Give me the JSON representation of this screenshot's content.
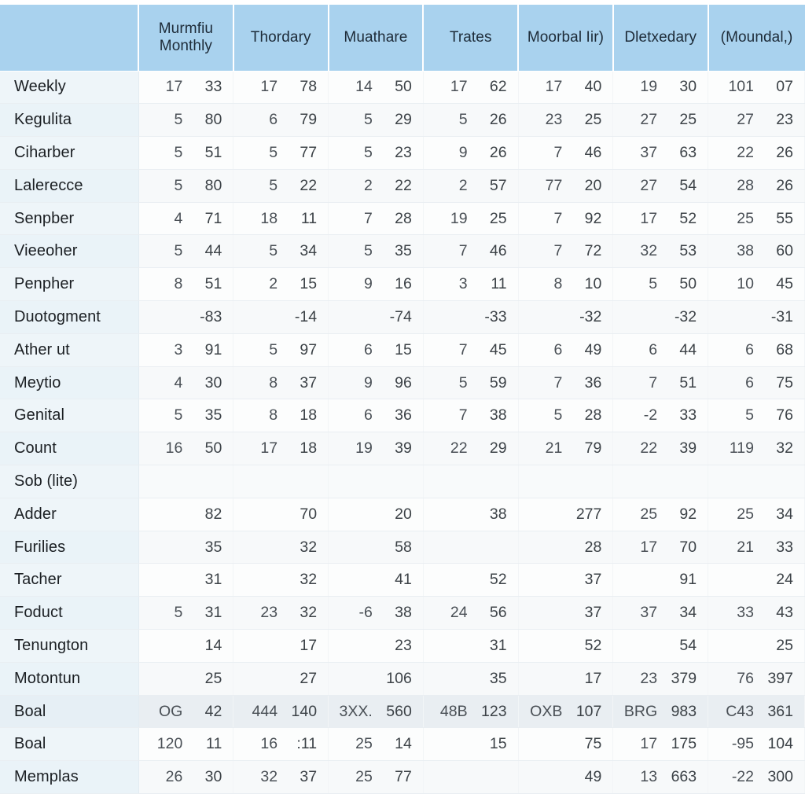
{
  "table": {
    "columns": [
      {
        "id": "rowlabel",
        "label": ""
      },
      {
        "id": "c1",
        "label": "Murmfiu Monthly"
      },
      {
        "id": "c2",
        "label": "Thordary"
      },
      {
        "id": "c3",
        "label": "Muathare"
      },
      {
        "id": "c4",
        "label": "Trates"
      },
      {
        "id": "c5",
        "label": "Moorbal Iir)"
      },
      {
        "id": "c6",
        "label": "Dletxedary"
      },
      {
        "id": "c7",
        "label": "(Moundal,)"
      }
    ],
    "rows": [
      {
        "label": "Weekly",
        "style": "normal",
        "cells": [
          [
            "17",
            "33"
          ],
          [
            "17",
            "78"
          ],
          [
            "14",
            "50"
          ],
          [
            "17",
            "62"
          ],
          [
            "17",
            "40"
          ],
          [
            "19",
            "30"
          ],
          [
            "101",
            "07"
          ]
        ]
      },
      {
        "label": "Kegulita",
        "style": "alt",
        "cells": [
          [
            "5",
            "80"
          ],
          [
            "6",
            "79"
          ],
          [
            "5",
            "29"
          ],
          [
            "5",
            "26"
          ],
          [
            "23",
            "25"
          ],
          [
            "27",
            "25"
          ],
          [
            "27",
            "23"
          ]
        ]
      },
      {
        "label": "Ciharber",
        "style": "normal",
        "cells": [
          [
            "5",
            "51"
          ],
          [
            "5",
            "77"
          ],
          [
            "5",
            "23"
          ],
          [
            "9",
            "26"
          ],
          [
            "7",
            "46"
          ],
          [
            "37",
            "63"
          ],
          [
            "22",
            "26"
          ]
        ]
      },
      {
        "label": "Lalerecce",
        "style": "alt",
        "cells": [
          [
            "5",
            "80"
          ],
          [
            "5",
            "22"
          ],
          [
            "2",
            "22"
          ],
          [
            "2",
            "57"
          ],
          [
            "77",
            "20"
          ],
          [
            "27",
            "54"
          ],
          [
            "28",
            "26"
          ]
        ]
      },
      {
        "label": "Senpber",
        "style": "normal",
        "cells": [
          [
            "4",
            "71"
          ],
          [
            "18",
            "11"
          ],
          [
            "7",
            "28"
          ],
          [
            "19",
            "25"
          ],
          [
            "7",
            "92"
          ],
          [
            "17",
            "52"
          ],
          [
            "25",
            "55"
          ]
        ]
      },
      {
        "label": "Vieeoher",
        "style": "alt",
        "cells": [
          [
            "5",
            "44"
          ],
          [
            "5",
            "34"
          ],
          [
            "5",
            "35"
          ],
          [
            "7",
            "46"
          ],
          [
            "7",
            "72"
          ],
          [
            "32",
            "53"
          ],
          [
            "38",
            "60"
          ]
        ]
      },
      {
        "label": "Penpher",
        "style": "normal",
        "cells": [
          [
            "8",
            "51"
          ],
          [
            "2",
            "15"
          ],
          [
            "9",
            "16"
          ],
          [
            "3",
            "11"
          ],
          [
            "8",
            "10"
          ],
          [
            "5",
            "50"
          ],
          [
            "10",
            "45"
          ]
        ]
      },
      {
        "label": "Duotogment",
        "style": "alt",
        "cells": [
          [
            "",
            "-83"
          ],
          [
            "",
            "-14"
          ],
          [
            "",
            "-74"
          ],
          [
            "",
            "-33"
          ],
          [
            "",
            "-32"
          ],
          [
            "",
            "-32"
          ],
          [
            "",
            "-31"
          ]
        ]
      },
      {
        "label": "Ather ut",
        "style": "normal",
        "cells": [
          [
            "3",
            "91"
          ],
          [
            "5",
            "97"
          ],
          [
            "6",
            "15"
          ],
          [
            "7",
            "45"
          ],
          [
            "6",
            "49"
          ],
          [
            "6",
            "44"
          ],
          [
            "6",
            "68"
          ]
        ]
      },
      {
        "label": "Meytio",
        "style": "alt",
        "cells": [
          [
            "4",
            "30"
          ],
          [
            "8",
            "37"
          ],
          [
            "9",
            "96"
          ],
          [
            "5",
            "59"
          ],
          [
            "7",
            "36"
          ],
          [
            "7",
            "51"
          ],
          [
            "6",
            "75"
          ]
        ]
      },
      {
        "label": "Genital",
        "style": "normal",
        "cells": [
          [
            "5",
            "35"
          ],
          [
            "8",
            "18"
          ],
          [
            "6",
            "36"
          ],
          [
            "7",
            "38"
          ],
          [
            "5",
            "28"
          ],
          [
            "-2",
            "33"
          ],
          [
            "5",
            "76"
          ]
        ]
      },
      {
        "label": "Count",
        "style": "alt",
        "cells": [
          [
            "16",
            "50"
          ],
          [
            "17",
            "18"
          ],
          [
            "19",
            "39"
          ],
          [
            "22",
            "29"
          ],
          [
            "21",
            "79"
          ],
          [
            "22",
            "39"
          ],
          [
            "119",
            "32"
          ]
        ]
      },
      {
        "label": "Sob (lite)",
        "style": "blank",
        "cells": [
          [
            "",
            ""
          ],
          [
            "",
            ""
          ],
          [
            "",
            ""
          ],
          [
            "",
            ""
          ],
          [
            "",
            ""
          ],
          [
            "",
            ""
          ],
          [
            "",
            ""
          ]
        ]
      },
      {
        "label": "Adder",
        "style": "normal",
        "cells": [
          [
            "",
            "82"
          ],
          [
            "",
            "70"
          ],
          [
            "",
            "20"
          ],
          [
            "",
            "38"
          ],
          [
            "",
            "277"
          ],
          [
            "25",
            "92"
          ],
          [
            "25",
            "34"
          ]
        ]
      },
      {
        "label": "Furilies",
        "style": "alt",
        "cells": [
          [
            "",
            "35"
          ],
          [
            "",
            "32"
          ],
          [
            "",
            "58"
          ],
          [
            "",
            ""
          ],
          [
            "",
            "28"
          ],
          [
            "17",
            "70"
          ],
          [
            "21",
            "33"
          ]
        ]
      },
      {
        "label": "Tacher",
        "style": "normal",
        "cells": [
          [
            "",
            "31"
          ],
          [
            "",
            "32"
          ],
          [
            "",
            "41"
          ],
          [
            "",
            "52"
          ],
          [
            "",
            "37"
          ],
          [
            "",
            "91"
          ],
          [
            "",
            "24"
          ]
        ]
      },
      {
        "label": "Foduct",
        "style": "alt",
        "cells": [
          [
            "5",
            "31"
          ],
          [
            "23",
            "32"
          ],
          [
            "-6",
            "38"
          ],
          [
            "24",
            "56"
          ],
          [
            "",
            "37"
          ],
          [
            "37",
            "34"
          ],
          [
            "33",
            "43"
          ]
        ]
      },
      {
        "label": "Tenungton",
        "style": "normal",
        "cells": [
          [
            "",
            "14"
          ],
          [
            "",
            "17"
          ],
          [
            "",
            "23"
          ],
          [
            "",
            "31"
          ],
          [
            "",
            "52"
          ],
          [
            "",
            "54"
          ],
          [
            "",
            "25"
          ]
        ]
      },
      {
        "label": "Motontun",
        "style": "alt",
        "cells": [
          [
            "",
            "25"
          ],
          [
            "",
            "27"
          ],
          [
            "",
            "106"
          ],
          [
            "",
            "35"
          ],
          [
            "",
            "17"
          ],
          [
            "23",
            "379"
          ],
          [
            "76",
            "397"
          ]
        ]
      },
      {
        "label": "Boal",
        "style": "hl",
        "cells": [
          [
            "OG",
            "42"
          ],
          [
            "444",
            "140"
          ],
          [
            "3XX.",
            "560"
          ],
          [
            "48B",
            "123"
          ],
          [
            "OXB",
            "107"
          ],
          [
            "BRG",
            "983"
          ],
          [
            "C43",
            "361"
          ]
        ]
      },
      {
        "label": "Boal",
        "style": "normal",
        "cells": [
          [
            "120",
            "11"
          ],
          [
            "16",
            ":11"
          ],
          [
            "25",
            "14"
          ],
          [
            "",
            "15"
          ],
          [
            "",
            "75"
          ],
          [
            "17",
            "175"
          ],
          [
            "-95",
            "104"
          ]
        ]
      },
      {
        "label": "Memplas",
        "style": "alt",
        "cells": [
          [
            "26",
            "30"
          ],
          [
            "32",
            "37"
          ],
          [
            "25",
            "77"
          ],
          [
            "",
            ""
          ],
          [
            "",
            "49"
          ],
          [
            "13",
            "663"
          ],
          [
            "-22",
            "300"
          ]
        ]
      }
    ]
  },
  "colors": {
    "header_bg": "#a9d2ee",
    "rowlabel_bg": "#eef5f9",
    "cell_bg": "#fcfdfd",
    "alt_cell_bg": "#f7f9fa",
    "highlight_bg": "#e9eef2",
    "text": "#3a3f44",
    "grid_line": "#e9eef2"
  }
}
